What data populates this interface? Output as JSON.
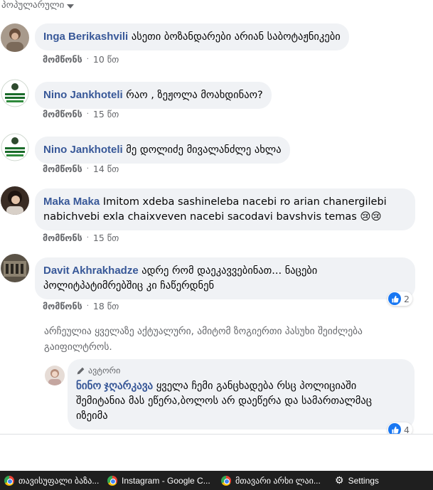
{
  "sort": {
    "label": "პოპულარული"
  },
  "comments": [
    {
      "author": "Inga Berikashvili",
      "text": "ასეთი ბოზანდარები არიან საბოტაჟნიკები",
      "like_label": "მომწონს",
      "time": "10 წთ"
    },
    {
      "author": "Nino Jankhoteli",
      "text": "რაო , ზეჟოლა მოახდინაო?",
      "like_label": "მომწონს",
      "time": "15 წთ"
    },
    {
      "author": "Nino Jankhoteli",
      "text": "მე დოლიძე მივალანძლე ახლა",
      "like_label": "მომწონს",
      "time": "14 წთ"
    },
    {
      "author": "Maka Maka",
      "text": "Imitom xdeba sashineleba nacebi ro arian chanergilebi nabichvebi exla chaixveven nacebi sacodavi bavshvis temas",
      "emoji": "😢😢",
      "like_label": "მომწონს",
      "time": "15 წთ"
    },
    {
      "author": "Davit Akhrakhadze",
      "text": "ადრე რომ დაეკავვებინათ... ნაცები პოლიტპატიმრებშიც კი ჩაწერდნენ",
      "like_label": "მომწონს",
      "time": "18 წთ",
      "reactions": "2"
    }
  ],
  "notice": "არჩეულია ყველაზე აქტუალური, ამიტომ ზოგიერთი პასუხი შეიძლება გაიფილტროს.",
  "reply": {
    "badge": "ავტორი",
    "author": "ნინო ჯღარკავა",
    "text": "ყველა ჩემი განცხადება რსც პოლიციაში შემიტანია მას ეწერა,ბოლოს არ დაეწერა და სამართალმაც იზეიმა",
    "reactions": "4"
  },
  "taskbar": {
    "items": [
      "თავისუფალი ბაზა...",
      "Instagram - Google C...",
      "მთავარი არხი ლაი...",
      "Settings"
    ]
  }
}
